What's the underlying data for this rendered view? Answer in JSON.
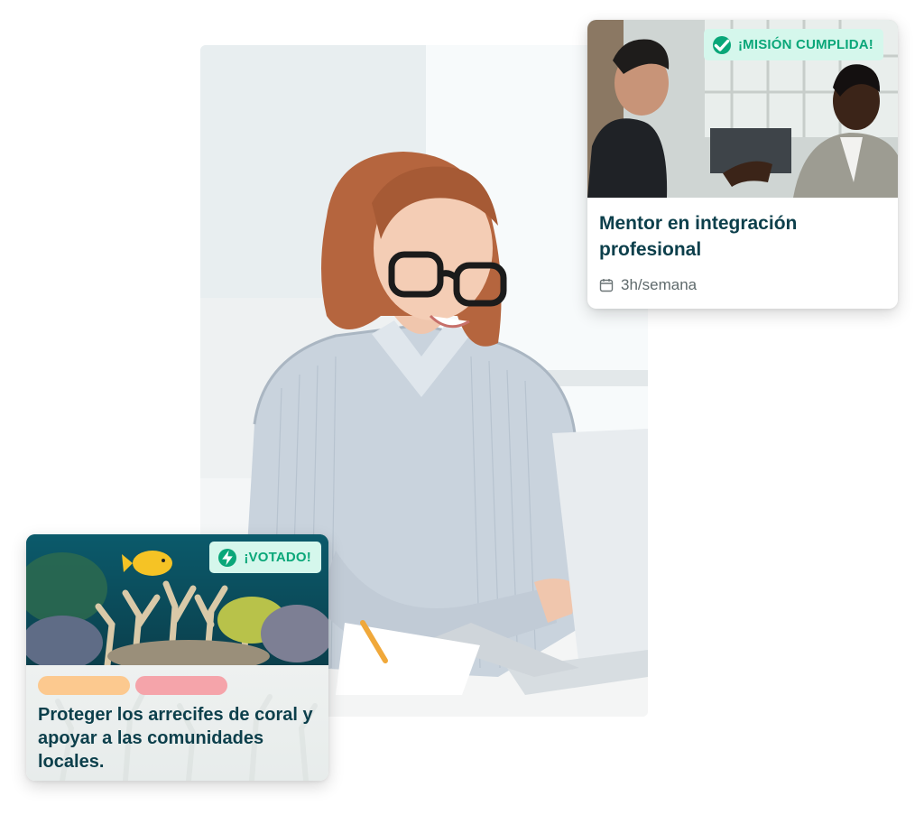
{
  "hero": {
    "photo": "woman-with-glasses-smiling-at-laptop"
  },
  "mentor_card": {
    "photo": "two-men-talking-in-office",
    "badge": {
      "icon": "check-circle-icon",
      "label": "¡MISIÓN CUMPLIDA!"
    },
    "title": "Mentor en integración profesional",
    "schedule": {
      "icon": "calendar-icon",
      "label": "3h/semana"
    }
  },
  "coral_card": {
    "photo": "coral-reef-with-yellow-fish",
    "badge": {
      "icon": "lightning-icon",
      "label": "¡VOTADO!"
    },
    "tags": [
      {
        "color": "#fcc98f"
      },
      {
        "color": "#f5a4aa"
      }
    ],
    "title": "Proteger los arrecifes de coral y apoyar a las comunidades locales."
  },
  "colors": {
    "accent_green": "#0aa779",
    "badge_bg": "#d5f7ec",
    "title_text": "#0c3f4b",
    "meta_text": "#5f6a6c"
  }
}
